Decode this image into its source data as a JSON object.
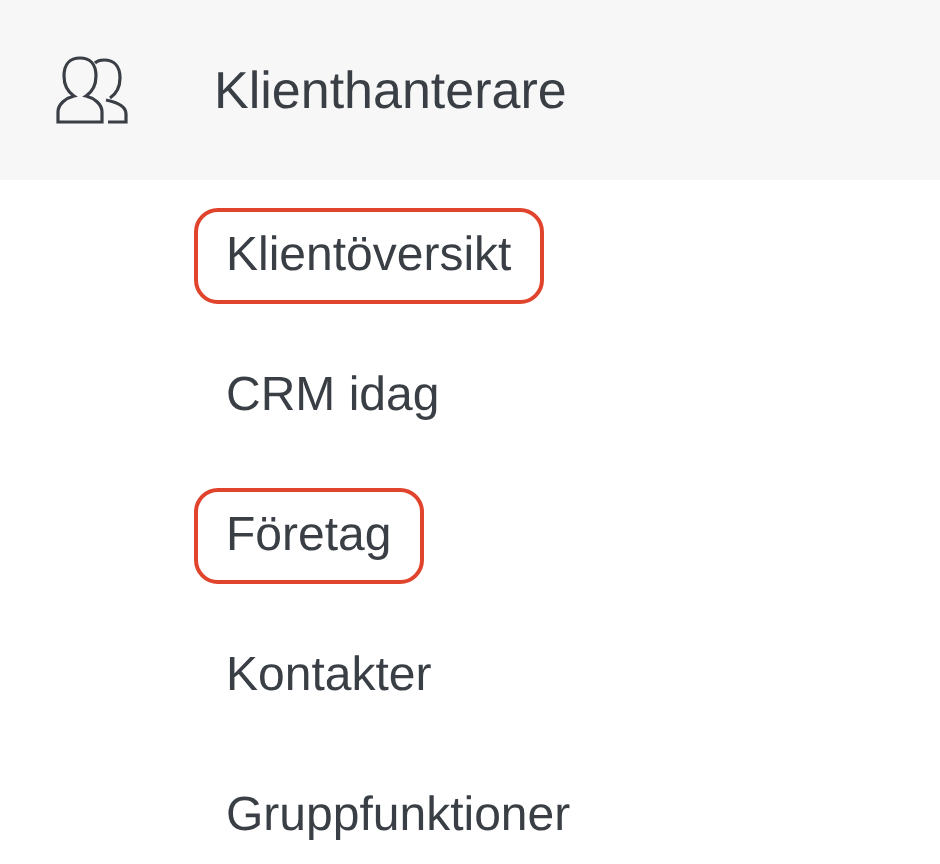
{
  "section": {
    "title": "Klienthanterare"
  },
  "items": [
    {
      "label": "Klientöversikt",
      "highlighted": true
    },
    {
      "label": "CRM idag",
      "highlighted": false
    },
    {
      "label": "Företag",
      "highlighted": true
    },
    {
      "label": "Kontakter",
      "highlighted": false
    },
    {
      "label": "Gruppfunktioner",
      "highlighted": false
    }
  ]
}
